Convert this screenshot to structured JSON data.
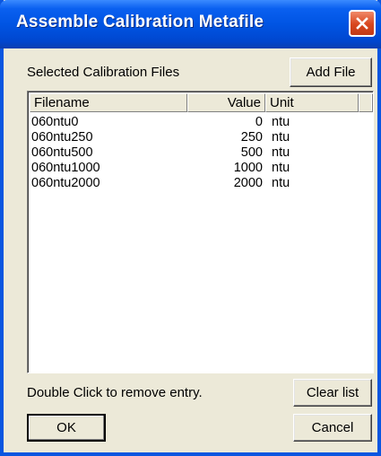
{
  "window": {
    "title": "Assemble Calibration Metafile"
  },
  "selected_label": "Selected Calibration Files",
  "buttons": {
    "add_file": "Add File",
    "clear_list": "Clear list",
    "ok": "OK",
    "cancel": "Cancel"
  },
  "list": {
    "columns": [
      "Filename",
      "Value",
      "Unit"
    ],
    "rows": [
      {
        "filename": "060ntu0",
        "value": "0",
        "unit": "ntu"
      },
      {
        "filename": "060ntu250",
        "value": "250",
        "unit": "ntu"
      },
      {
        "filename": "060ntu500",
        "value": "500",
        "unit": "ntu"
      },
      {
        "filename": "060ntu1000",
        "value": "1000",
        "unit": "ntu"
      },
      {
        "filename": "060ntu2000",
        "value": "2000",
        "unit": "ntu"
      }
    ]
  },
  "hint": "Double Click to remove entry.",
  "icons": {
    "close": "close-icon"
  },
  "colors": {
    "titlebar": "#0054e3",
    "close": "#d8461e",
    "dialog_bg": "#ece9d8"
  }
}
